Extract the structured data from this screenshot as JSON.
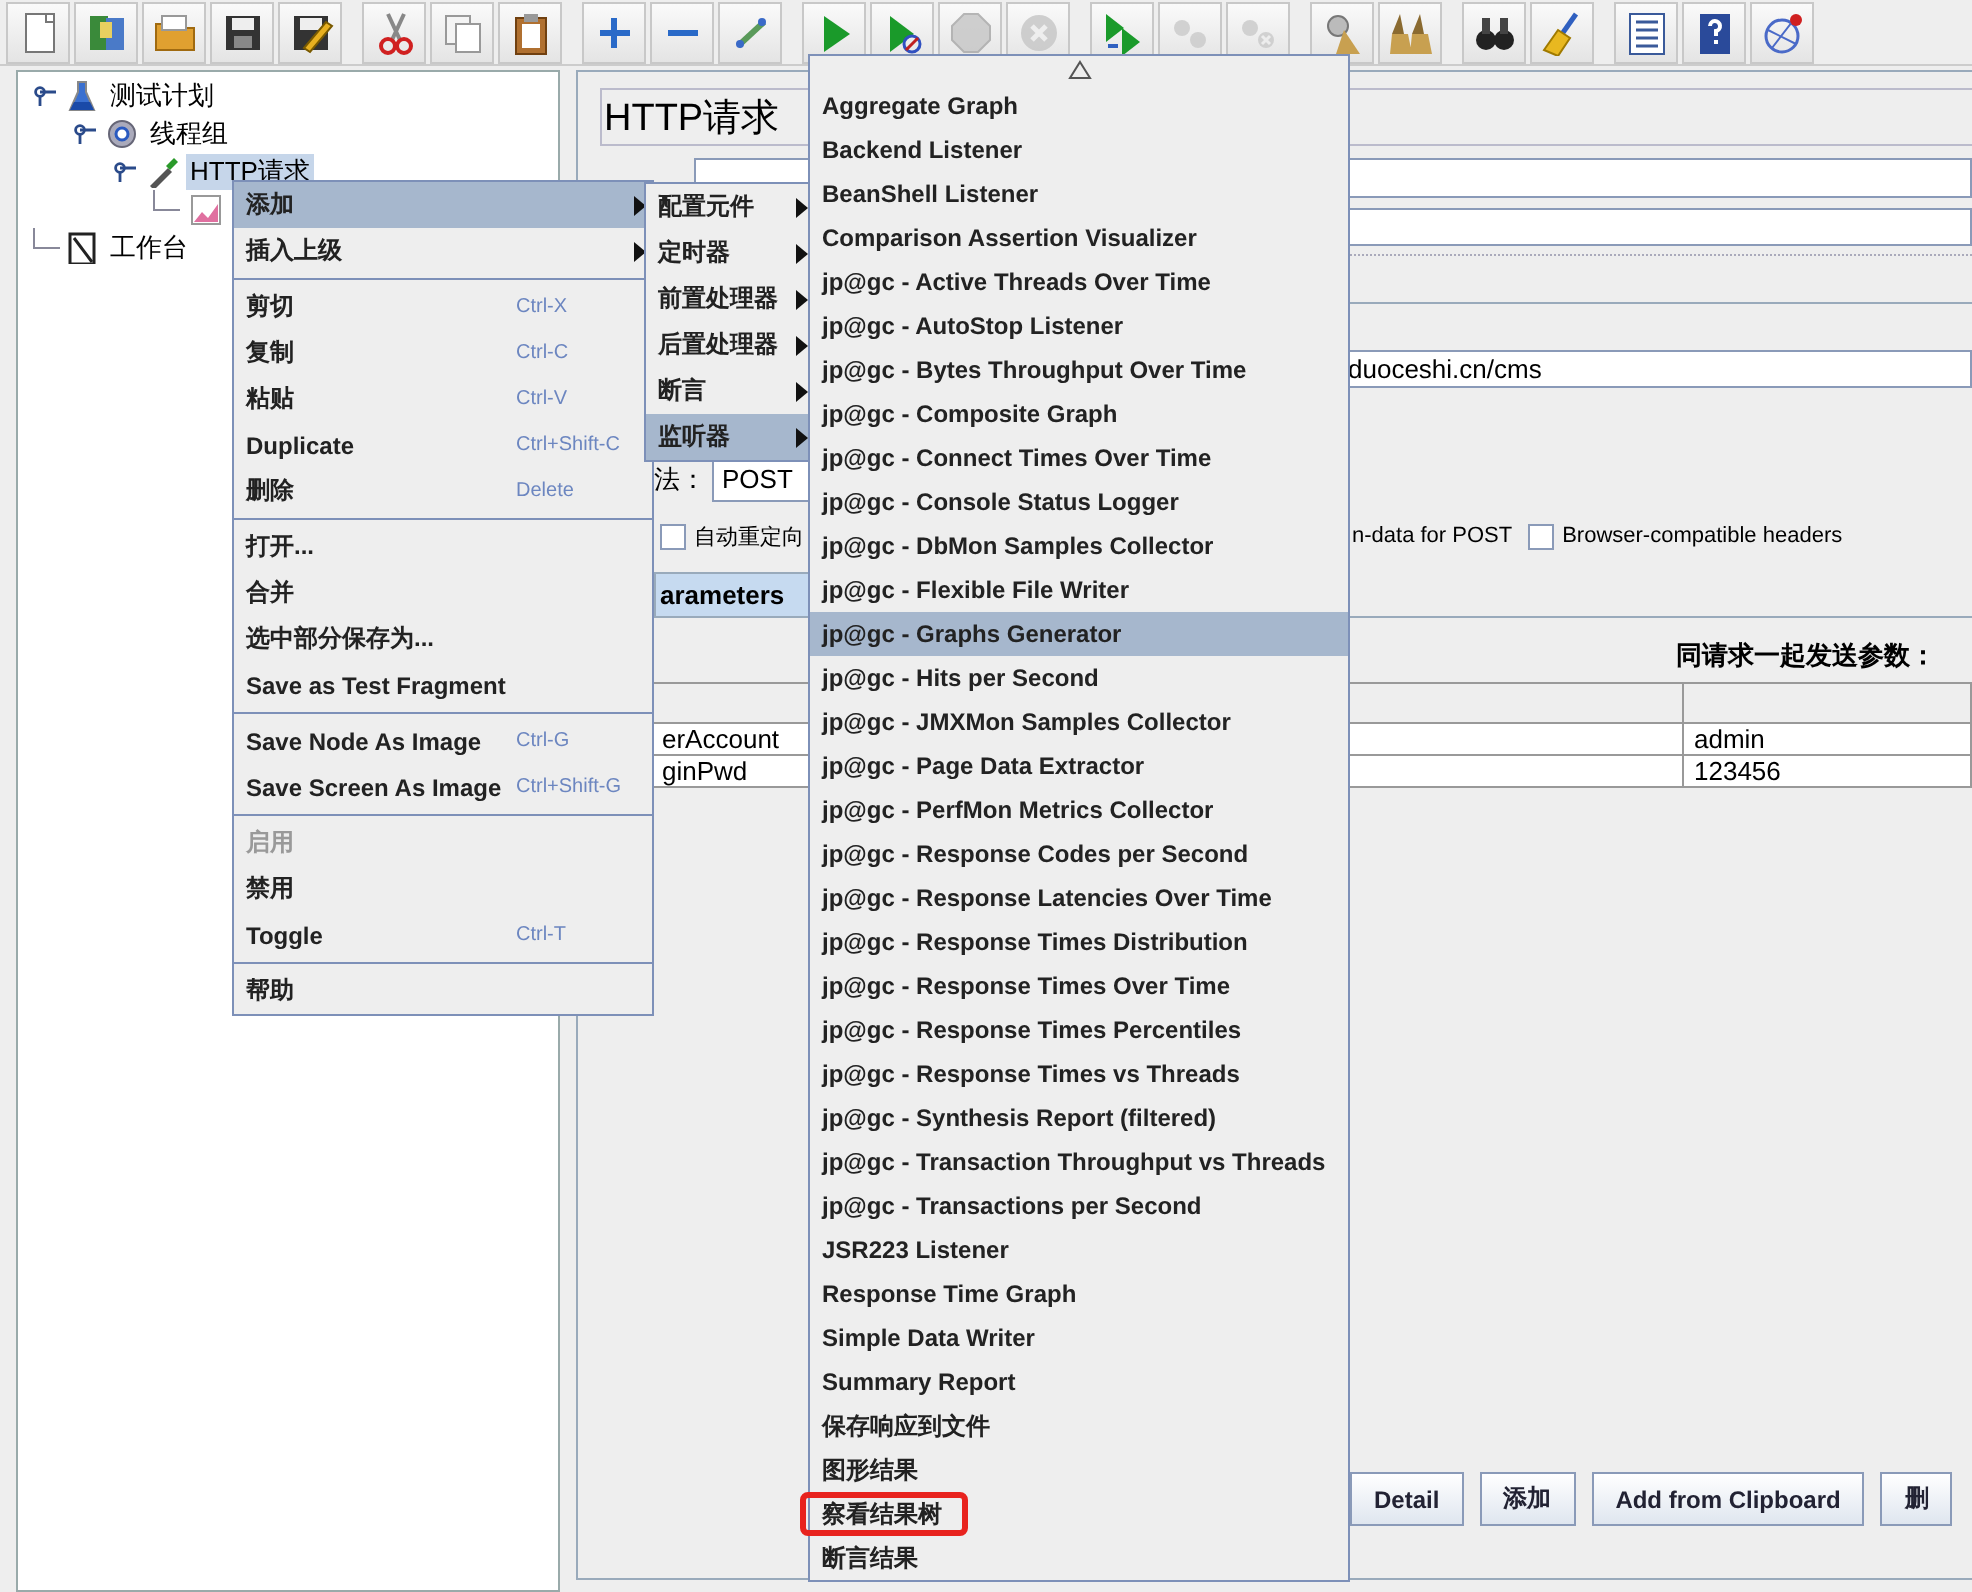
{
  "toolbar": [
    [
      {
        "kind": "new",
        "disabled": false
      },
      {
        "kind": "templates",
        "disabled": false
      },
      {
        "kind": "open",
        "disabled": false
      },
      {
        "kind": "save",
        "disabled": false
      },
      {
        "kind": "save-as",
        "disabled": false
      }
    ],
    [
      {
        "kind": "cut",
        "disabled": false
      },
      {
        "kind": "copy",
        "disabled": false
      },
      {
        "kind": "paste",
        "disabled": false
      }
    ],
    [
      {
        "kind": "expand",
        "disabled": false
      },
      {
        "kind": "collapse",
        "disabled": false
      },
      {
        "kind": "toggle",
        "disabled": false
      }
    ],
    [
      {
        "kind": "start",
        "disabled": false
      },
      {
        "kind": "start-no-pause",
        "disabled": false
      },
      {
        "kind": "stop",
        "disabled": true
      },
      {
        "kind": "shutdown",
        "disabled": true
      }
    ],
    [
      {
        "kind": "remote-start",
        "disabled": false
      },
      {
        "kind": "remote-stop",
        "disabled": true
      },
      {
        "kind": "remote-shutdown",
        "disabled": true
      }
    ],
    [
      {
        "kind": "clear",
        "disabled": false
      },
      {
        "kind": "clear-all",
        "disabled": false
      }
    ],
    [
      {
        "kind": "search",
        "disabled": false
      },
      {
        "kind": "reset-search",
        "disabled": false
      }
    ],
    [
      {
        "kind": "function-helper",
        "disabled": false
      },
      {
        "kind": "help",
        "disabled": false
      },
      {
        "kind": "log",
        "disabled": false
      }
    ]
  ],
  "tree": [
    {
      "kind": "plan",
      "label": "测试计划",
      "selected": false,
      "expanded": true,
      "children": [
        {
          "kind": "thread-group",
          "label": "线程组",
          "selected": false,
          "expanded": true,
          "children": [
            {
              "kind": "sampler",
              "label": "HTTP请求",
              "selected": true,
              "expanded": true,
              "children": [
                {
                  "kind": "listener",
                  "selected": false
                }
              ]
            }
          ]
        }
      ]
    },
    {
      "kind": "workbench",
      "label": "工作台",
      "selected": false
    }
  ],
  "editor": {
    "title": "HTTP请求",
    "path_value": "duoceshi.cn/cms",
    "method_label": "法：",
    "method_value": "POST",
    "options": [
      {
        "kind": "checkbox",
        "label": "自动重定向",
        "checked": false
      },
      {
        "kind": "text",
        "label": "n-data for POST"
      },
      {
        "kind": "checkbox",
        "label": "Browser-compatible headers",
        "checked": false
      }
    ],
    "tabs": [
      {
        "label": "arameters",
        "selected": true
      }
    ],
    "params_title": "同请求一起发送参数：",
    "table": {
      "rows": [
        [
          "erAccount",
          "admin"
        ],
        [
          "ginPwd",
          "123456"
        ]
      ]
    },
    "buttons": [
      "Detail",
      "添加",
      "Add from Clipboard",
      "删"
    ]
  },
  "context_menu": {
    "groups": [
      [
        {
          "label": "添加",
          "submenu": true,
          "selected": true,
          "disabled": false
        },
        {
          "label": "插入上级",
          "submenu": true,
          "selected": false,
          "disabled": false
        }
      ],
      [
        {
          "label": "剪切",
          "shortcut": "Ctrl-X",
          "selected": false,
          "disabled": false
        },
        {
          "label": "复制",
          "shortcut": "Ctrl-C",
          "selected": false,
          "disabled": false
        },
        {
          "label": "粘贴",
          "shortcut": "Ctrl-V",
          "selected": false,
          "disabled": false
        },
        {
          "label": "Duplicate",
          "shortcut": "Ctrl+Shift-C",
          "selected": false,
          "disabled": false
        },
        {
          "label": "删除",
          "shortcut": "Delete",
          "selected": false,
          "disabled": false
        }
      ],
      [
        {
          "label": "打开...",
          "selected": false,
          "disabled": false
        },
        {
          "label": "合并",
          "selected": false,
          "disabled": false
        },
        {
          "label": "选中部分保存为...",
          "selected": false,
          "disabled": false
        },
        {
          "label": "Save as Test Fragment",
          "selected": false,
          "disabled": false
        }
      ],
      [
        {
          "label": "Save Node As Image",
          "shortcut": "Ctrl-G",
          "selected": false,
          "disabled": false
        },
        {
          "label": "Save Screen As Image",
          "shortcut": "Ctrl+Shift-G",
          "selected": false,
          "disabled": false
        }
      ],
      [
        {
          "label": "启用",
          "selected": false,
          "disabled": true
        },
        {
          "label": "禁用",
          "selected": false,
          "disabled": false
        },
        {
          "label": "Toggle",
          "shortcut": "Ctrl-T",
          "selected": false,
          "disabled": false
        }
      ],
      [
        {
          "label": "帮助",
          "selected": false,
          "disabled": false
        }
      ]
    ]
  },
  "add_menu": {
    "groups": [
      [
        {
          "label": "配置元件",
          "submenu": true,
          "selected": false,
          "disabled": false
        },
        {
          "label": "定时器",
          "submenu": true,
          "selected": false,
          "disabled": false
        },
        {
          "label": "前置处理器",
          "submenu": true,
          "selected": false,
          "disabled": false
        },
        {
          "label": "后置处理器",
          "submenu": true,
          "selected": false,
          "disabled": false
        },
        {
          "label": "断言",
          "submenu": true,
          "selected": false,
          "disabled": false
        },
        {
          "label": "监听器",
          "submenu": true,
          "selected": true,
          "disabled": false
        }
      ]
    ]
  },
  "listener_menu": {
    "scroll_up": true,
    "groups": [
      [
        {
          "label": "Aggregate Graph",
          "selected": false,
          "marked": false
        },
        {
          "label": "Backend Listener",
          "selected": false,
          "marked": false
        },
        {
          "label": "BeanShell Listener",
          "selected": false,
          "marked": false
        },
        {
          "label": "Comparison Assertion Visualizer",
          "selected": false,
          "marked": false
        },
        {
          "label": "jp@gc - Active Threads Over Time",
          "selected": false,
          "marked": false
        },
        {
          "label": "jp@gc - AutoStop Listener",
          "selected": false,
          "marked": false
        },
        {
          "label": "jp@gc - Bytes Throughput Over Time",
          "selected": false,
          "marked": false
        },
        {
          "label": "jp@gc - Composite Graph",
          "selected": false,
          "marked": false
        },
        {
          "label": "jp@gc - Connect Times Over Time",
          "selected": false,
          "marked": false
        },
        {
          "label": "jp@gc - Console Status Logger",
          "selected": false,
          "marked": false
        },
        {
          "label": "jp@gc - DbMon Samples Collector",
          "selected": false,
          "marked": false
        },
        {
          "label": "jp@gc - Flexible File Writer",
          "selected": false,
          "marked": false
        },
        {
          "label": "jp@gc - Graphs Generator",
          "selected": true,
          "marked": false
        },
        {
          "label": "jp@gc - Hits per Second",
          "selected": false,
          "marked": false
        },
        {
          "label": "jp@gc - JMXMon Samples Collector",
          "selected": false,
          "marked": false
        },
        {
          "label": "jp@gc - Page Data Extractor",
          "selected": false,
          "marked": false
        },
        {
          "label": "jp@gc - PerfMon Metrics Collector",
          "selected": false,
          "marked": false
        },
        {
          "label": "jp@gc - Response Codes per Second",
          "selected": false,
          "marked": false
        },
        {
          "label": "jp@gc - Response Latencies Over Time",
          "selected": false,
          "marked": false
        },
        {
          "label": "jp@gc - Response Times Distribution",
          "selected": false,
          "marked": false
        },
        {
          "label": "jp@gc - Response Times Over Time",
          "selected": false,
          "marked": false
        },
        {
          "label": "jp@gc - Response Times Percentiles",
          "selected": false,
          "marked": false
        },
        {
          "label": "jp@gc - Response Times vs Threads",
          "selected": false,
          "marked": false
        },
        {
          "label": "jp@gc - Synthesis Report (filtered)",
          "selected": false,
          "marked": false
        },
        {
          "label": "jp@gc - Transaction Throughput vs Threads",
          "selected": false,
          "marked": false
        },
        {
          "label": "jp@gc - Transactions per Second",
          "selected": false,
          "marked": false
        },
        {
          "label": "JSR223 Listener",
          "selected": false,
          "marked": false
        },
        {
          "label": "Response Time Graph",
          "selected": false,
          "marked": false
        },
        {
          "label": "Simple Data Writer",
          "selected": false,
          "marked": false
        },
        {
          "label": "Summary Report",
          "selected": false,
          "marked": false
        },
        {
          "label": "保存响应到文件",
          "selected": false,
          "marked": false
        },
        {
          "label": "图形结果",
          "selected": false,
          "marked": false
        },
        {
          "label": "察看结果树",
          "selected": false,
          "marked": true
        },
        {
          "label": "断言结果",
          "selected": false,
          "marked": false
        }
      ]
    ]
  }
}
